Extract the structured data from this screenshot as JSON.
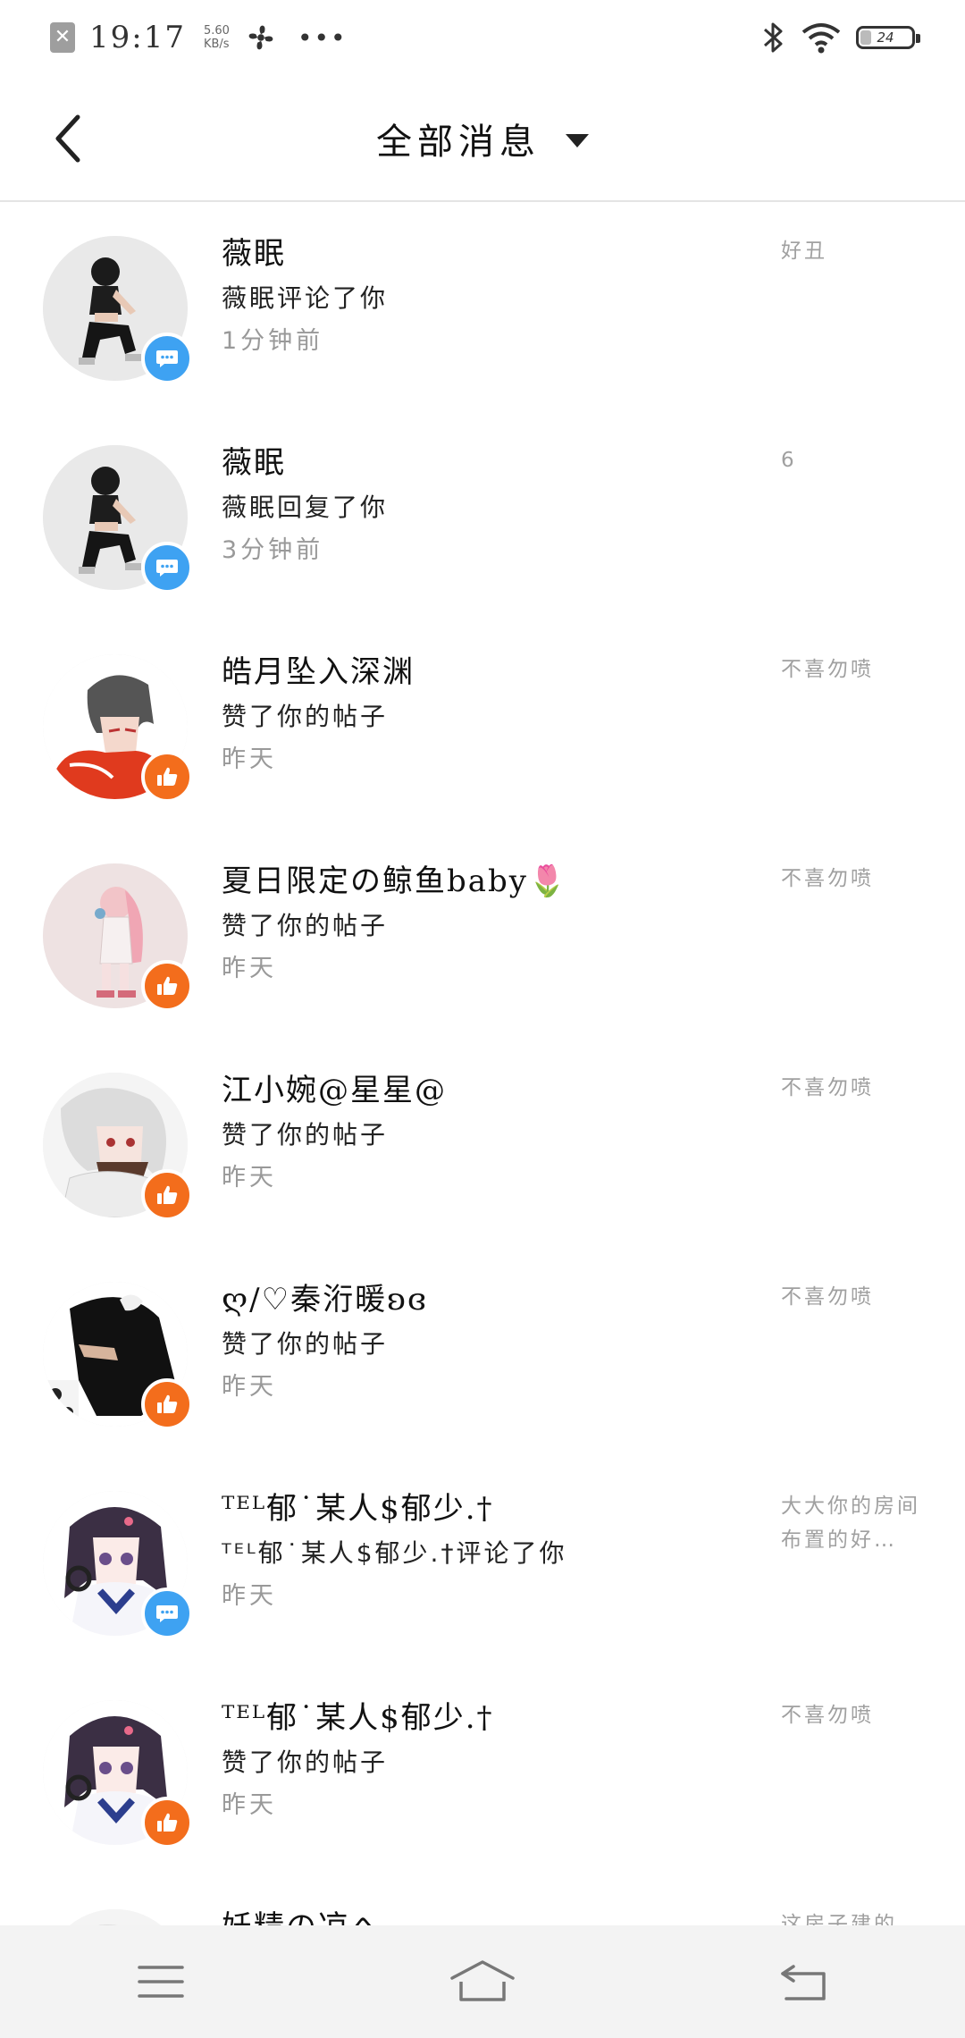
{
  "status_bar": {
    "time": "19:17",
    "speed_value": "5.60",
    "speed_unit": "KB/s",
    "more": "•••",
    "battery": "24"
  },
  "header": {
    "title": "全部消息"
  },
  "messages": [
    {
      "name": "薇眠",
      "action": "薇眠评论了你",
      "time": "1分钟前",
      "ref": "好丑",
      "type": "comment",
      "avatar": "girl-crouching"
    },
    {
      "name": "薇眠",
      "action": "薇眠回复了你",
      "time": "3分钟前",
      "ref": "6",
      "type": "comment",
      "avatar": "girl-crouching"
    },
    {
      "name": "皓月坠入深渊",
      "action": "赞了你的帖子",
      "time": "昨天",
      "ref": "不喜勿喷",
      "type": "like",
      "avatar": "boy-red-hood"
    },
    {
      "name": "夏日限定の鲸鱼baby🌷",
      "action": "赞了你的帖子",
      "time": "昨天",
      "ref": "不喜勿喷",
      "type": "like",
      "avatar": "pink-hair-girl"
    },
    {
      "name": "江小婉@星星@",
      "action": "赞了你的帖子",
      "time": "昨天",
      "ref": "不喜勿喷",
      "type": "like",
      "avatar": "white-hair-girl"
    },
    {
      "name": "ღ/♡秦洐暖ʚɞ",
      "action": "赞了你的帖子",
      "time": "昨天",
      "ref": "不喜勿喷",
      "type": "like",
      "avatar": "dark-hair-photo"
    },
    {
      "name": "ᵀᴱᴸ郁˙某人$郁少.†",
      "action": "ᵀᴱᴸ郁˙某人$郁少.†评论了你",
      "time": "昨天",
      "ref": "大大你的房间布置的好…",
      "type": "comment",
      "avatar": "purple-hair-girl"
    },
    {
      "name": "ᵀᴱᴸ郁˙某人$郁少.†",
      "action": "赞了你的帖子",
      "time": "昨天",
      "ref": "不喜勿喷",
      "type": "like",
      "avatar": "purple-hair-girl"
    },
    {
      "name": "妖精の凉へ",
      "action": "",
      "time": "",
      "ref": "这房子建的",
      "type": "like",
      "avatar": "white-hair-girl"
    }
  ],
  "colors": {
    "comment_badge": "#3ea2f2",
    "like_badge": "#f36d1c",
    "secondary_text": "#999999",
    "divider": "#e4e4e4",
    "navbar_bg": "#f3f3f3"
  }
}
